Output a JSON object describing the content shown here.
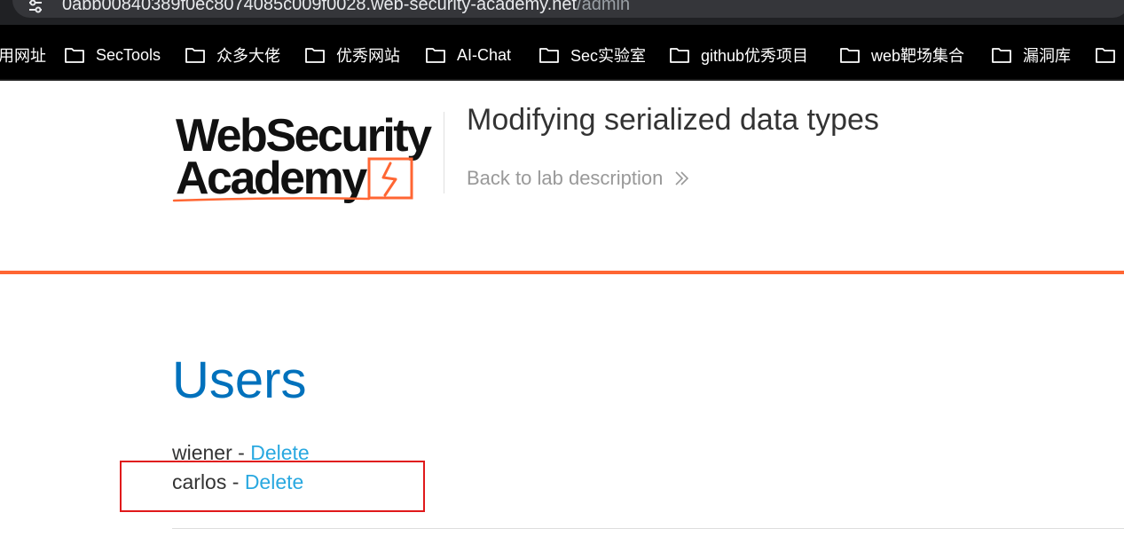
{
  "browser": {
    "url_host": "0abb00840389f0ec8074085c009f0028.web-security-academy.net",
    "url_path": "/admin"
  },
  "bookmarks": [
    {
      "label": "用网址"
    },
    {
      "label": "SecTools"
    },
    {
      "label": "众多大佬"
    },
    {
      "label": "优秀网站"
    },
    {
      "label": "AI-Chat"
    },
    {
      "label": "Sec实验室"
    },
    {
      "label": "github优秀项目"
    },
    {
      "label": "web靶场集合"
    },
    {
      "label": "漏洞库"
    },
    {
      "label": ""
    }
  ],
  "header": {
    "logo_line1": "WebSecurity",
    "logo_line2": "Academy",
    "lab_title": "Modifying serialized data types",
    "back_link": "Back to lab description"
  },
  "main": {
    "heading": "Users",
    "users": [
      {
        "name": "wiener",
        "separator": " - ",
        "action": "Delete"
      },
      {
        "name": "carlos",
        "separator": " - ",
        "action": "Delete"
      }
    ]
  },
  "colors": {
    "accent_orange": "#ff6633",
    "heading_blue": "#0071bc",
    "link_blue": "#29a8e0",
    "annotation_red": "#e0191b"
  }
}
